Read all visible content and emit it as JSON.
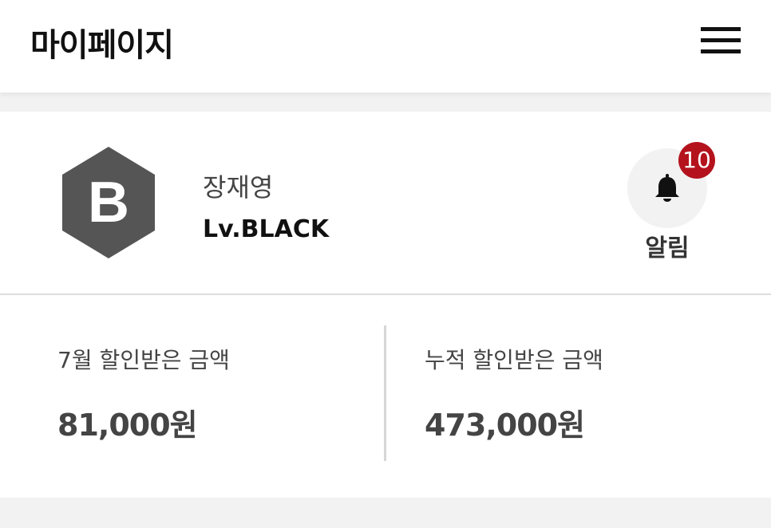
{
  "header": {
    "title": "마이페이지",
    "menu_icon": "hamburger-menu-icon"
  },
  "profile": {
    "badge_letter": "B",
    "badge_color": "#555555",
    "name": "장재영",
    "level": "Lv.BLACK"
  },
  "notification": {
    "icon": "bell-icon",
    "count": "10",
    "count_color": "#b4131d",
    "label": "알림"
  },
  "stats": {
    "monthly": {
      "label": "7월 할인받은 금액",
      "value": "81,000원"
    },
    "cumulative": {
      "label": "누적 할인받은 금액",
      "value": "473,000원"
    }
  }
}
